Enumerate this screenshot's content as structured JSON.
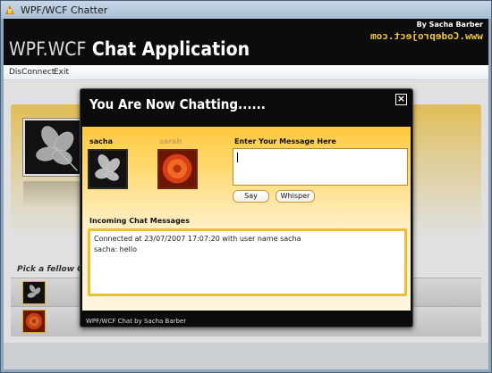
{
  "window": {
    "title": "WPF/WCF Chatter"
  },
  "header": {
    "title_prefix": "WPF.WCF",
    "title_main": "Chat Application",
    "byline": "By Sacha Barber",
    "site": "www.Codeproject.com"
  },
  "menu": {
    "disconnect": "DisConnect",
    "exit": "Exit"
  },
  "main": {
    "pick_label": "Pick a fellow Chatter"
  },
  "dialog": {
    "title": "You Are Now Chatting......",
    "me_name": "sacha",
    "other_name": "sarah",
    "message_label": "Enter Your Message Here",
    "say_label": "Say",
    "whisper_label": "Whisper",
    "incoming_label": "Incoming Chat Messages",
    "messages": [
      "Connected at 23/07/2007 17:07:20 with user name sacha",
      "sacha: hello"
    ],
    "footer": "WPF/WCF Chat by Sacha Barber"
  },
  "icons": {
    "app": "app-flame-icon",
    "close": "close-icon",
    "leaf": "leaf-image",
    "flower": "flower-image"
  },
  "colors": {
    "accent": "#ffc93f",
    "header_bg": "#0c0c0c",
    "site_text": "#f2c53a"
  }
}
